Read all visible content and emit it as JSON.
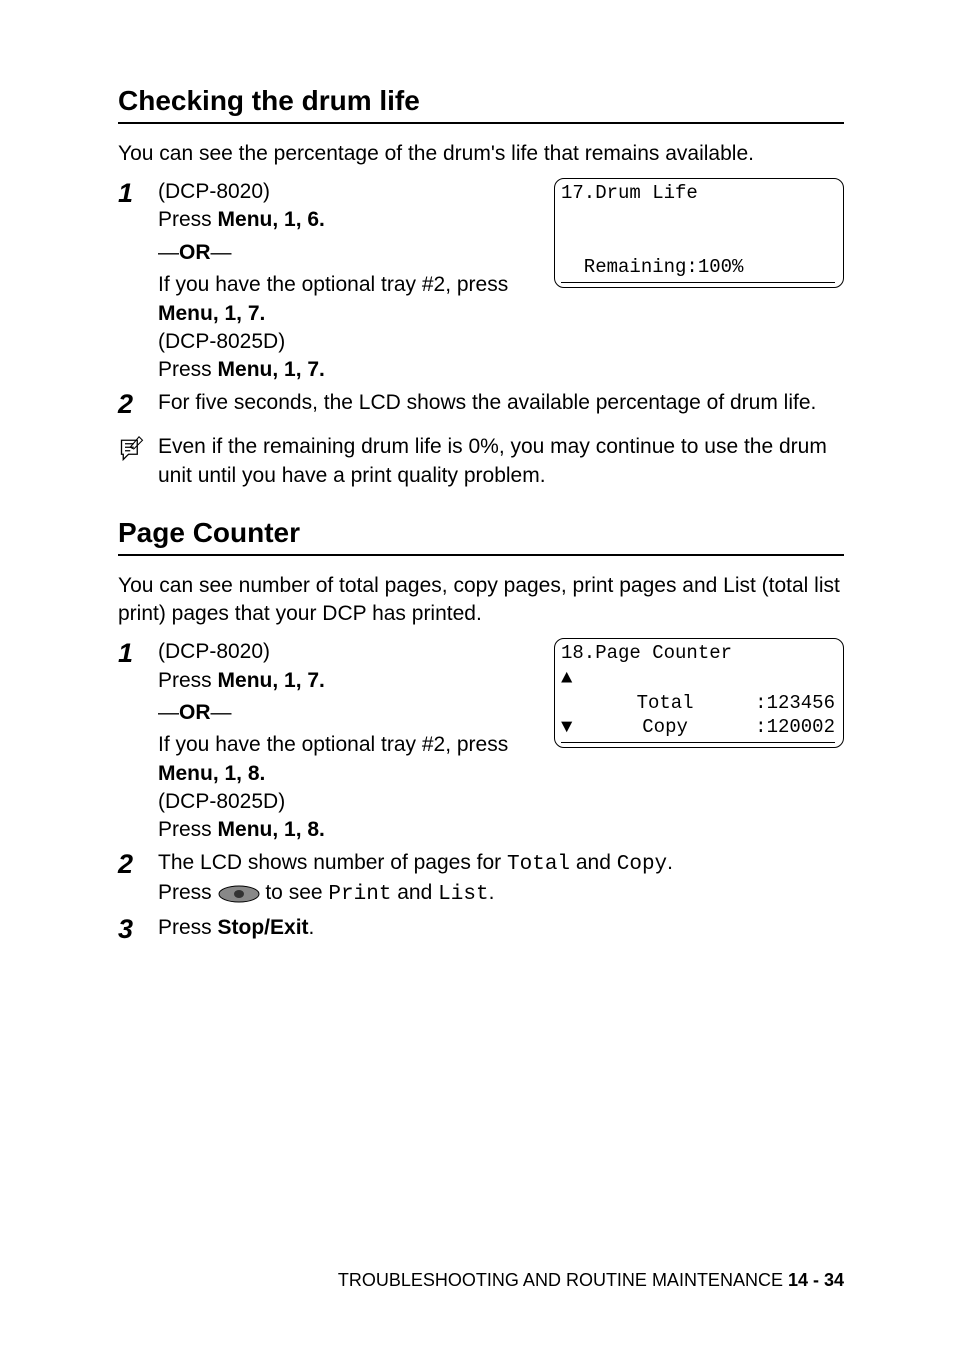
{
  "section1": {
    "heading": "Checking the drum life",
    "intro": "You can see the percentage of the drum's life that remains available.",
    "step1": {
      "model_a": "(DCP-8020)",
      "press_a_prefix": "Press ",
      "press_a_menu": "Menu",
      "press_a_keys": ", 1, 6.",
      "or": "OR",
      "tray_line": "If you have the optional tray #2, press ",
      "tray_menu": "Menu",
      "tray_keys": ", 1, 7.",
      "model_b": "(DCP-8025D)",
      "press_b_prefix": "Press ",
      "press_b_menu": "Menu",
      "press_b_keys": ", 1, 7."
    },
    "lcd": {
      "title": "17.Drum Life",
      "remaining": "  Remaining:100%"
    },
    "step2": "For five seconds, the LCD shows the available percentage of drum life.",
    "note": "Even if the remaining drum life is 0%, you may continue to use the drum unit until you have a print quality problem."
  },
  "section2": {
    "heading": "Page Counter",
    "intro": "You can see number of total pages, copy pages, print pages and List (total list print) pages that your DCP has printed.",
    "step1": {
      "model_a": "(DCP-8020)",
      "press_a_prefix": "Press ",
      "press_a_menu": "Menu",
      "press_a_keys": ", 1, 7.",
      "or": "OR",
      "tray_line": "If you have the optional tray #2, press ",
      "tray_menu": "Menu",
      "tray_keys": ", 1, 8.",
      "model_b": "(DCP-8025D)",
      "press_b_prefix": "Press ",
      "press_b_menu": "Menu",
      "press_b_keys": ", 1, 8."
    },
    "lcd": {
      "title": "18.Page Counter",
      "total_label": "Total",
      "total_val": ":123456",
      "copy_label": "Copy",
      "copy_val": ":120002"
    },
    "step2": {
      "line1_a": "The LCD shows number of pages for ",
      "line1_total": "Total",
      "line1_b": " and ",
      "line1_copy": "Copy",
      "line1_c": ".",
      "line2_a": "Press ",
      "line2_b": " to see ",
      "line2_print": "Print",
      "line2_c": " and ",
      "line2_list": "List",
      "line2_d": "."
    },
    "step3_a": "Press ",
    "step3_b": "Stop/Exit",
    "step3_c": "."
  },
  "footer": {
    "text": "TROUBLESHOOTING AND ROUTINE MAINTENANCE   ",
    "page": "14 - 34"
  },
  "steps": {
    "n1": "1",
    "n2": "2",
    "n3": "3"
  }
}
